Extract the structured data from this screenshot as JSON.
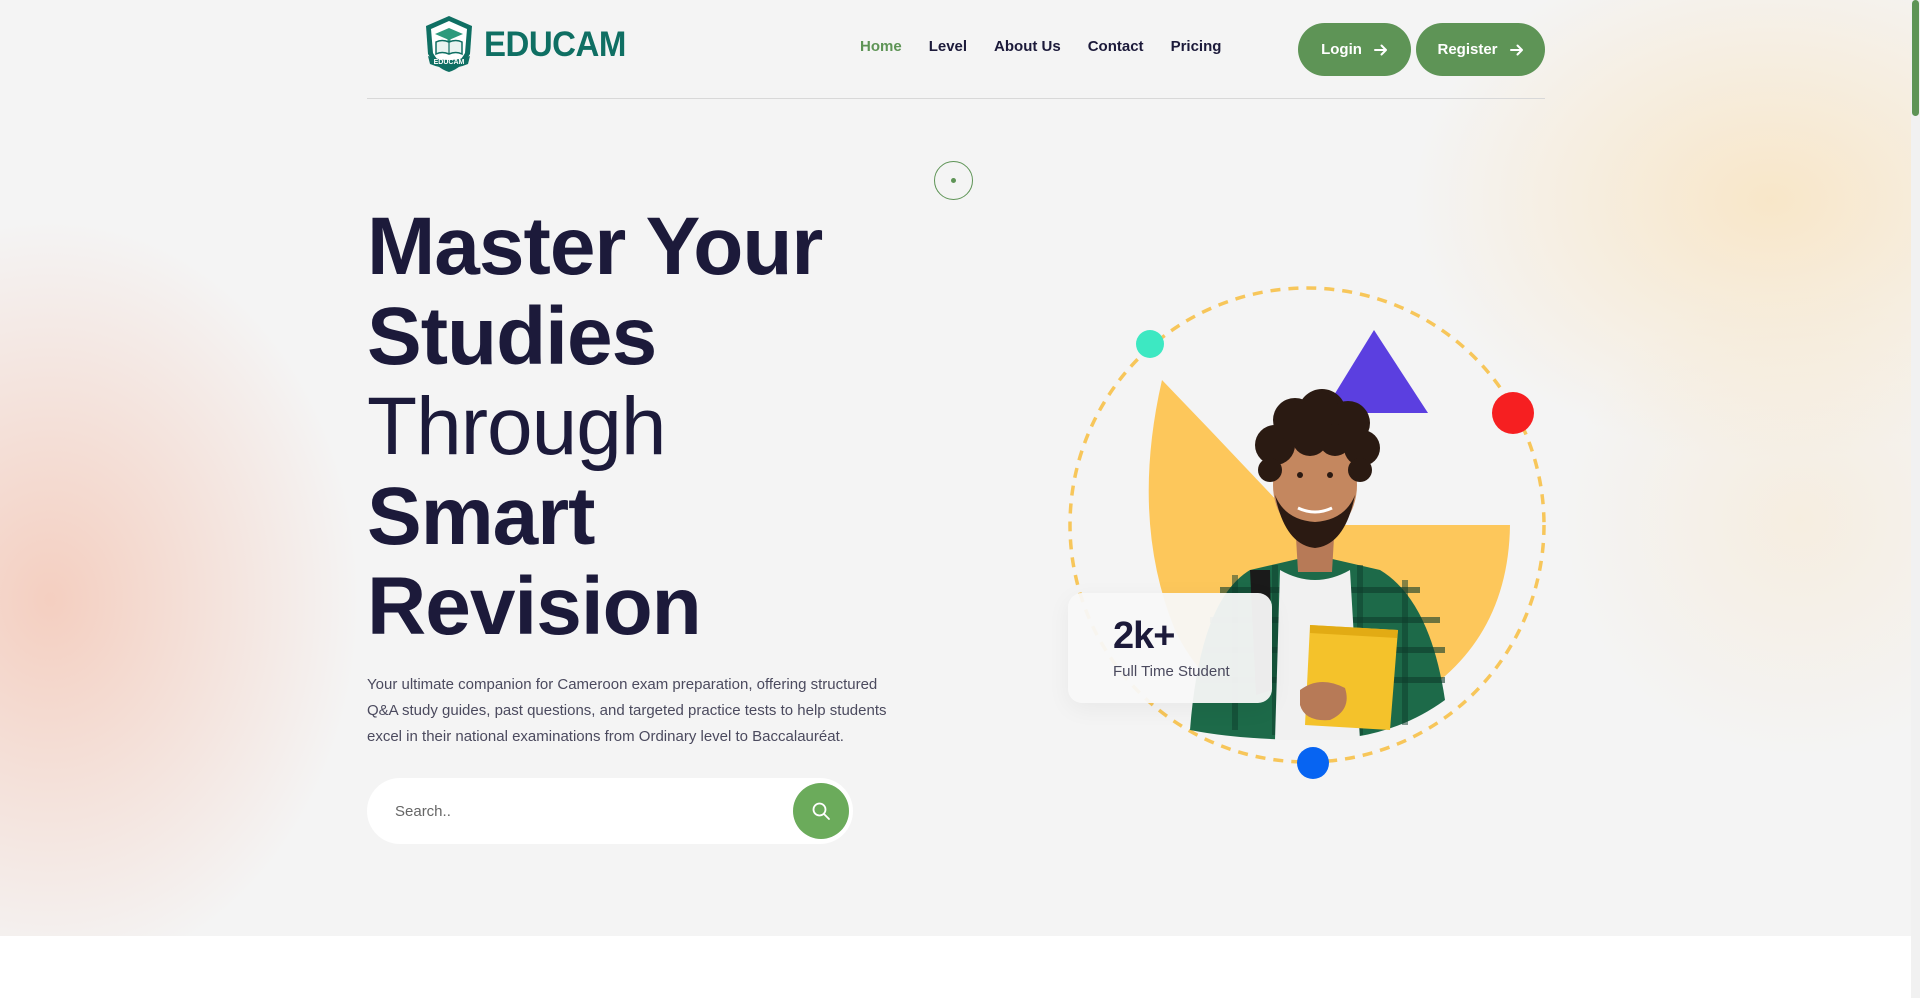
{
  "brand": {
    "name": "EDUCAM",
    "badge_text": "EDUCAM",
    "color": "#0f6f63"
  },
  "nav": {
    "items": [
      {
        "label": "Home",
        "active": true
      },
      {
        "label": "Level",
        "active": false
      },
      {
        "label": "About Us",
        "active": false
      },
      {
        "label": "Contact",
        "active": false
      },
      {
        "label": "Pricing",
        "active": false
      }
    ],
    "login_label": "Login",
    "register_label": "Register"
  },
  "hero": {
    "heading_line1": "Master Your",
    "heading_line2": "Studies",
    "heading_line3": "Through",
    "heading_line4": "Smart",
    "heading_line5": "Revision",
    "description": "Your ultimate companion for Cameroon exam preparation, offering structured Q&A study guides, past questions, and targeted practice tests to help students excel in their national examinations from Ordinary level to Baccalauréat.",
    "search_placeholder": "Search.."
  },
  "stats": {
    "number": "2k+",
    "label": "Full Time Student"
  },
  "colors": {
    "accent": "#5e9456",
    "search_button": "#6bab5b",
    "heading": "#1c1a3a",
    "ring": "#f7c65a",
    "blob": "#fdc75b",
    "triangle": "#5b3fe0",
    "dot_red": "#f61f21",
    "dot_blue": "#0764f2",
    "dot_teal": "#3de8c2"
  },
  "icons": [
    "logo-badge-icon",
    "arrow-right-icon",
    "search-icon",
    "student-photo-illustration"
  ]
}
